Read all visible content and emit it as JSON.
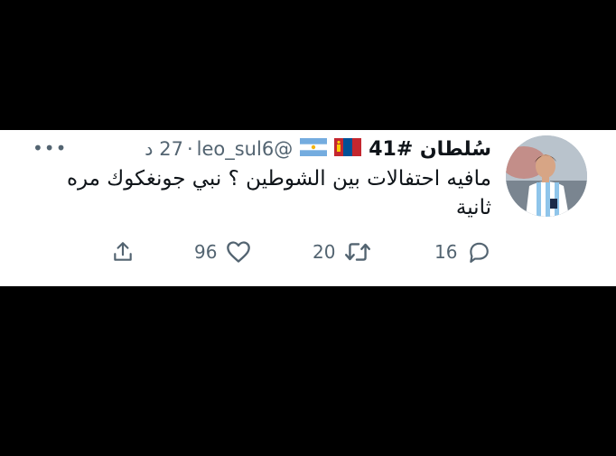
{
  "tweet": {
    "display_name": "سُلطان #41",
    "handle": "@leo_sul6",
    "separator": "·",
    "time": "27 د",
    "more": "•••",
    "text": "مافيه احتفالات بين الشوطين ؟ نبي جونغكوك مره ثانية"
  },
  "actions": {
    "reply_count": "16",
    "retweet_count": "20",
    "like_count": "96"
  },
  "icons": {
    "flag_1": "mongolia-flag-icon",
    "flag_2": "argentina-flag-icon",
    "reply": "reply-icon",
    "retweet": "retweet-icon",
    "like": "heart-icon",
    "share": "share-icon"
  },
  "colors": {
    "text": "#0f1419",
    "muted": "#536471",
    "background": "#ffffff"
  }
}
